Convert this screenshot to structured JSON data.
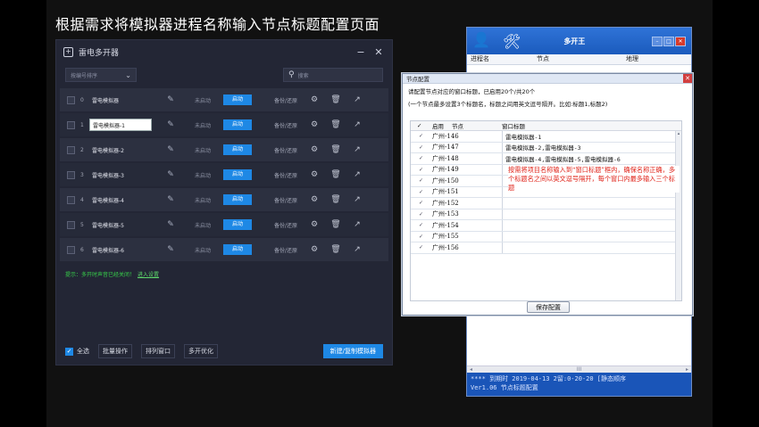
{
  "heading": "根据需求将模拟器进程名称输入节点标题配置页面",
  "leidian": {
    "title": "雷电多开器",
    "minimize": "−",
    "close": "✕",
    "sort_select": "按编号排序",
    "search_placeholder": "搜索",
    "rows": [
      {
        "idx": "0",
        "name": "雷电模拟器",
        "status": "未启动",
        "start": "启动",
        "backup": "备份/还原"
      },
      {
        "idx": "1",
        "name": "雷电模拟器-1",
        "status": "未启动",
        "start": "启动",
        "backup": "备份/还原"
      },
      {
        "idx": "2",
        "name": "雷电模拟器-2",
        "status": "未启动",
        "start": "启动",
        "backup": "备份/还原"
      },
      {
        "idx": "3",
        "name": "雷电模拟器-3",
        "status": "未启动",
        "start": "启动",
        "backup": "备份/还原"
      },
      {
        "idx": "4",
        "name": "雷电模拟器-4",
        "status": "未启动",
        "start": "启动",
        "backup": "备份/还原"
      },
      {
        "idx": "5",
        "name": "雷电模拟器-5",
        "status": "未启动",
        "start": "启动",
        "backup": "备份/还原"
      },
      {
        "idx": "6",
        "name": "雷电模拟器-6",
        "status": "未启动",
        "start": "启动",
        "backup": "备份/还原"
      }
    ],
    "tip": "提示：多开时声音已经关闭！",
    "tip_link": "进入设置",
    "select_all": "全选",
    "batch": "批量操作",
    "arrange": "排列窗口",
    "optimize": "多开优化",
    "new_copy": "新建/复制模拟器"
  },
  "duokai": {
    "title": "多开王",
    "columns": [
      "进程名",
      "节点",
      "地理"
    ],
    "footer_line1": "**** 到期时 2019-04-13 2留:0-20-20 [静态顺序",
    "footer_line2": "Ver1.06        节点标题配置"
  },
  "dialog": {
    "title": "节点配置",
    "close": "✕",
    "line1": "请配置节点对应的窗口标题，已启用20个/共20个",
    "line2": "(一个节点最多设置3个标题名，标题之间用英文逗号隔开。比如:标题1,标题2)",
    "col_enable": "启用",
    "col_node": "节点",
    "col_window": "窗口标题",
    "rows": [
      {
        "node": "广州-146",
        "title": "雷电模拟器-1"
      },
      {
        "node": "广州-147",
        "title": "雷电模拟器-2,雷电模拟器-3"
      },
      {
        "node": "广州-148",
        "title": "雷电模拟器-4,雷电模拟器-5,雷电模拟器-6"
      },
      {
        "node": "广州-149",
        "title": ""
      },
      {
        "node": "广州-150",
        "title": ""
      },
      {
        "node": "广州-151",
        "title": ""
      },
      {
        "node": "广州-152",
        "title": ""
      },
      {
        "node": "广州-153",
        "title": ""
      },
      {
        "node": "广州-154",
        "title": ""
      },
      {
        "node": "广州-155",
        "title": ""
      },
      {
        "node": "广州-156",
        "title": ""
      }
    ],
    "note": "按需将项目名称输入到“窗口标题”框内，确保名称正确，多个标题名之间以英文逗号隔开，每个窗口内最多输入三个标题",
    "save": "保存配置"
  }
}
